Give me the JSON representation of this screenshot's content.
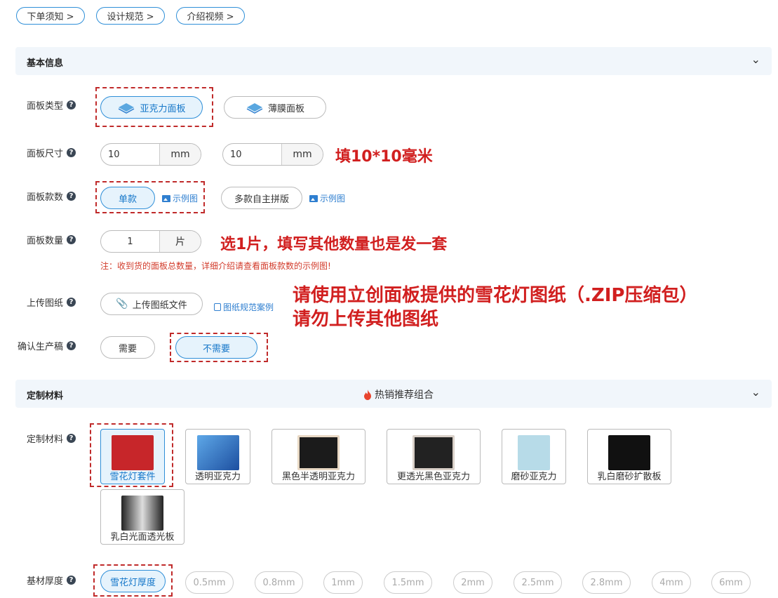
{
  "top_links": [
    "下单须知 >",
    "设计规范 >",
    "介绍视频 >"
  ],
  "basic_section": {
    "title": "基本信息"
  },
  "panel_type": {
    "label": "面板类型",
    "options": [
      "亚克力面板",
      "薄膜面板"
    ],
    "selected": "亚克力面板"
  },
  "panel_size": {
    "label": "面板尺寸",
    "width": "10",
    "height": "10",
    "unit": "mm",
    "annotation": "填10*10毫米"
  },
  "panel_styles": {
    "label": "面板款数",
    "options": [
      "单款",
      "多款自主拼版"
    ],
    "example_link": "示例图",
    "selected": "单款"
  },
  "panel_qty": {
    "label": "面板数量",
    "value": "1",
    "unit": "片",
    "annotation": "选1片，填写其他数量也是发一套",
    "note": "注：收到货的面板总数量，详细介绍请查看面板款数的示例图!"
  },
  "upload": {
    "label": "上传图纸",
    "button": "上传图纸文件",
    "spec_link": "图纸规范案例",
    "annotation_line1": "请使用立创面板提供的雪花灯图纸（.ZIP压缩包）",
    "annotation_line2": "请勿上传其他图纸"
  },
  "confirm": {
    "label": "确认生产稿",
    "options": [
      "需要",
      "不需要"
    ],
    "selected": "不需要"
  },
  "material_section": {
    "title": "定制材料",
    "badge": "热销推荐组合"
  },
  "material": {
    "label": "定制材料",
    "options": [
      "雪花灯套件",
      "透明亚克力",
      "黑色半透明亚克力",
      "更透光黑色亚克力",
      "磨砂亚克力",
      "乳白磨砂扩散板",
      "乳白光面透光板"
    ],
    "selected": "雪花灯套件"
  },
  "thickness": {
    "label": "基材厚度",
    "options": [
      "雪花灯厚度",
      "0.5mm",
      "0.8mm",
      "1mm",
      "1.5mm",
      "2mm",
      "2.5mm",
      "2.8mm",
      "4mm",
      "6mm"
    ],
    "selected": "雪花灯厚度"
  }
}
